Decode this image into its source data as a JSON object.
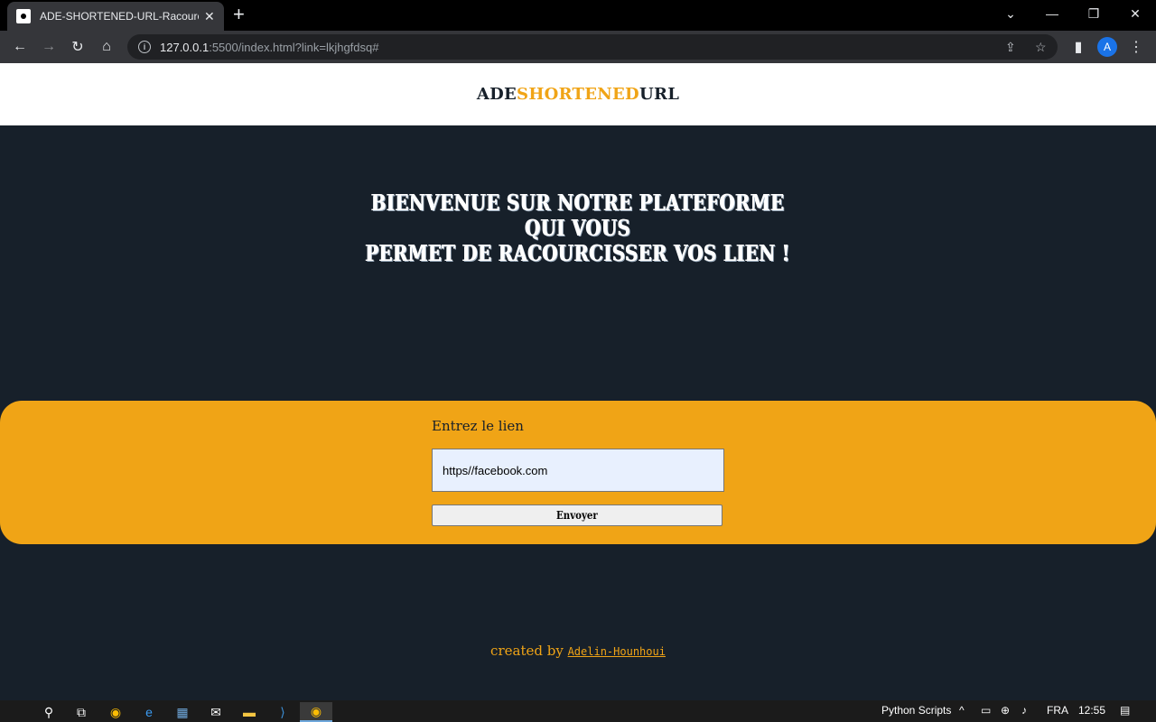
{
  "browser": {
    "tab_title": "ADE-SHORTENED-URL-Racourcis",
    "url_host": "127.0.0.1",
    "url_rest": ":5500/index.html?link=lkjhgfdsq#",
    "profile_initial": "A"
  },
  "header": {
    "logo_part1": "ADE",
    "logo_part2": "SHORTENED",
    "logo_part3": "URL"
  },
  "main": {
    "welcome_line1": "Bienvenue sur notre plateforme qui vous",
    "welcome_line2": "permet de racourcisser vos lien !"
  },
  "form": {
    "label": "Entrez le lien",
    "input_value": "https//facebook.com",
    "submit_label": "Envoyer"
  },
  "footer": {
    "prefix": "created by",
    "author_link": "Adelin-Hounhoui"
  },
  "taskbar": {
    "python_scripts": "Python Scripts",
    "language": "FRA",
    "time": "12:55"
  },
  "colors": {
    "accent": "#f0a416",
    "background": "#17202a"
  }
}
